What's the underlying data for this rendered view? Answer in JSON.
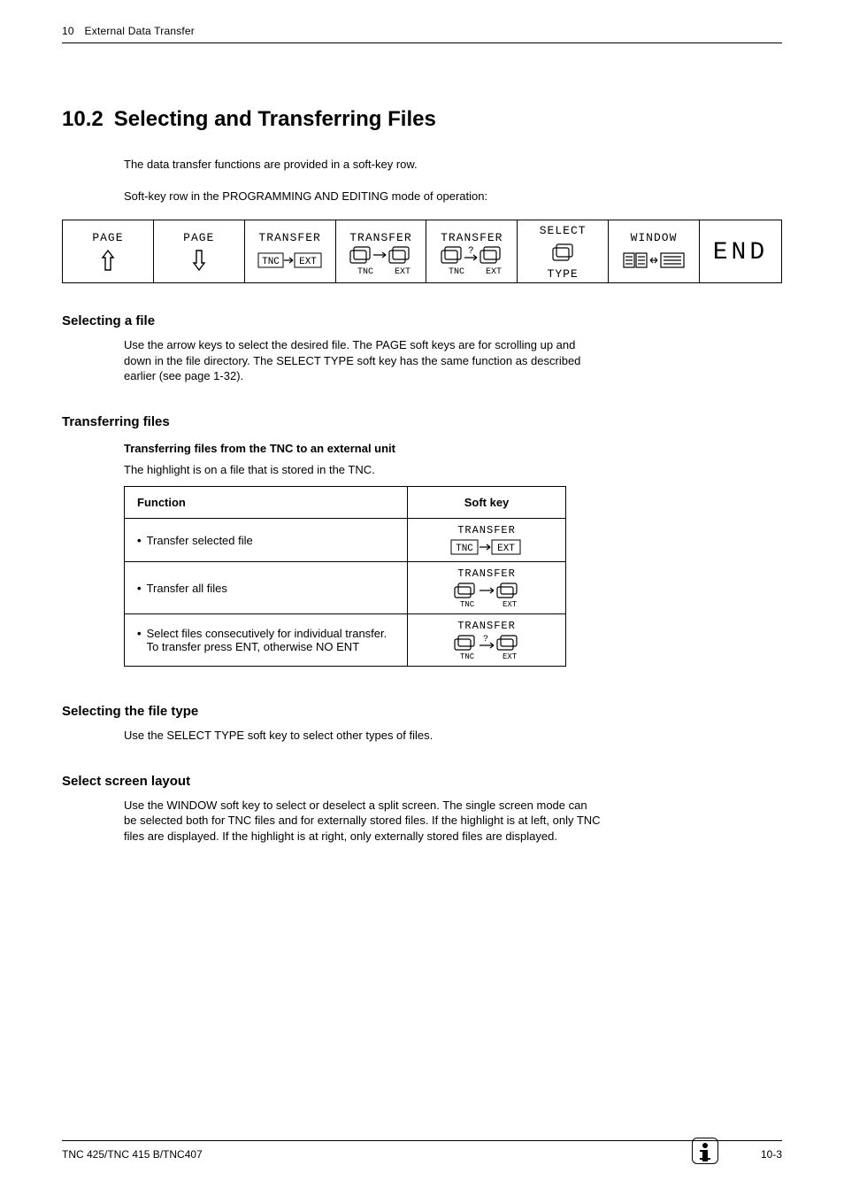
{
  "header": {
    "chapter_num": "10",
    "chapter_title": "External Data Transfer"
  },
  "section": {
    "number": "10.2",
    "title": "Selecting and Transferring Files",
    "intro1": "The data transfer functions are provided in a soft-key row.",
    "intro2": "Soft-key row in the PROGRAMMING AND EDITING mode of operation:"
  },
  "softkeys": {
    "page_up": "PAGE",
    "page_down": "PAGE",
    "transfer_tnc_ext": "TRANSFER",
    "transfer_all": "TRANSFER",
    "transfer_sel": "TRANSFER",
    "select_type_l1": "SELECT",
    "select_type_l2": "TYPE",
    "window": "WINDOW",
    "end": "END",
    "tnc": "TNC",
    "ext": "EXT"
  },
  "selecting_file": {
    "heading": "Selecting a file",
    "para": "Use the arrow keys to select the desired file. The PAGE soft keys are for scrolling up and down in the file directory. The SELECT TYPE soft key has the same function as described earlier (see page 1-32)."
  },
  "transferring": {
    "heading": "Transferring files",
    "sub": "Transferring files from the TNC to an external unit",
    "para": "The highlight is on a file that is stored in the TNC.",
    "table": {
      "h1": "Function",
      "h2": "Soft key",
      "rows": [
        {
          "fn": "Transfer selected file",
          "sk": "TRANSFER"
        },
        {
          "fn": "Transfer all files",
          "sk": "TRANSFER"
        },
        {
          "fn": "Select files consecutively for individual transfer. To transfer press ENT, otherwise NO ENT",
          "sk": "TRANSFER"
        }
      ]
    }
  },
  "select_type": {
    "heading": "Selecting the file type",
    "para": "Use the SELECT TYPE soft key to select other types of files."
  },
  "screen_layout": {
    "heading": "Select screen layout",
    "para": "Use the WINDOW soft key to select or deselect a split screen. The single screen mode can be selected both for TNC files and for externally stored files. If the highlight is at left, only TNC files are displayed. If the highlight is at right, only externally stored files are displayed."
  },
  "footer": {
    "left": "TNC 425/TNC 415 B/TNC407",
    "right": "10-3"
  }
}
